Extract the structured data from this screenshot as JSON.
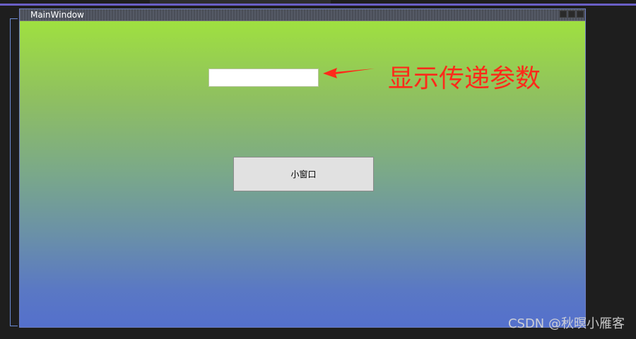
{
  "window": {
    "title": "MainWindow"
  },
  "form": {
    "line_edit_value": "",
    "button_label": "小窗口"
  },
  "annotation": {
    "text": "显示传递参数",
    "color": "#ff2a1a"
  },
  "watermark": {
    "text": "CSDN @秋暝小雁客"
  },
  "colors": {
    "gradient_top": "#9fe040",
    "gradient_bottom": "#5470cc",
    "accent": "#6a5fc7"
  }
}
